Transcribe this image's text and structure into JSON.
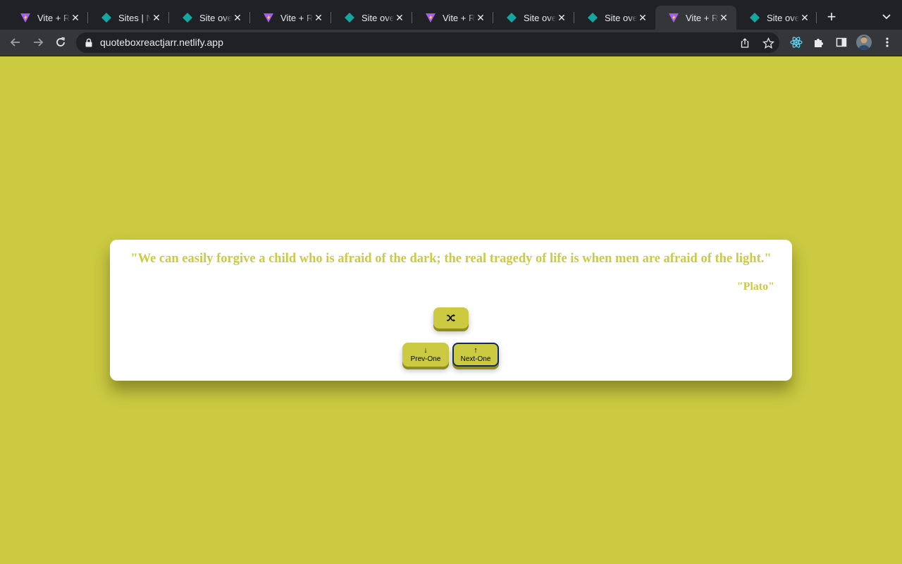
{
  "browser": {
    "tabs": [
      {
        "title": "Vite + React",
        "favicon": "vite-icon"
      },
      {
        "title": "Sites | Netlify",
        "favicon": "netlify-icon"
      },
      {
        "title": "Site overview",
        "favicon": "netlify-icon"
      },
      {
        "title": "Vite + React",
        "favicon": "vite-icon"
      },
      {
        "title": "Site overview",
        "favicon": "netlify-icon"
      },
      {
        "title": "Vite + React",
        "favicon": "vite-icon"
      },
      {
        "title": "Site overview",
        "favicon": "netlify-icon"
      },
      {
        "title": "Site overview",
        "favicon": "netlify-icon"
      },
      {
        "title": "Vite + React",
        "favicon": "vite-icon",
        "active": true
      },
      {
        "title": "Site overview",
        "favicon": "netlify-icon"
      }
    ],
    "url": "quoteboxreactjarr.netlify.app"
  },
  "page": {
    "background_color": "#cbca41",
    "quote_text": "\"We can easily forgive a child who is afraid of the dark; the real tragedy of life is when men are afraid of the light.\"",
    "author": "\"Plato\"",
    "random_button_icon": "shuffle-icon",
    "prev_button": {
      "arrow": "↓",
      "label": "Prev-One"
    },
    "next_button": {
      "arrow": "↑",
      "label": "Next-One"
    }
  },
  "colors": {
    "accent": "#cbca41",
    "card": "#ffffff",
    "tab_bar": "#202124",
    "toolbar": "#35363a"
  }
}
